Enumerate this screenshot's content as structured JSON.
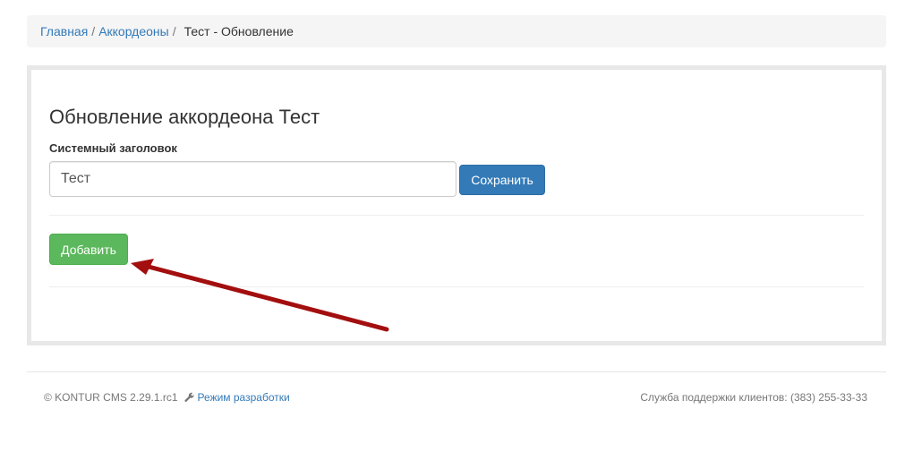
{
  "breadcrumb": {
    "home": "Главная",
    "separator": "/",
    "section": "Аккордеоны",
    "current": "Тест - Обновление"
  },
  "form": {
    "title": "Обновление аккордеона Тест",
    "field_label": "Системный заголовок",
    "field_value": "Тест",
    "save_label": "Сохранить",
    "add_label": "Добавить"
  },
  "annotation": {
    "arrow_color": "#a30e0e",
    "icon": "arrow-pointer-icon"
  },
  "footer": {
    "copyright": "© KONTUR CMS 2.29.1.rc1",
    "dev_icon": "wrench-icon",
    "dev_mode_link": "Режим разработки",
    "support": "Служба поддержки клиентов: (383) 255-33-33"
  },
  "colors": {
    "primary": "#337ab7",
    "success": "#5cb85c",
    "breadcrumb_bg": "#f5f5f5",
    "panel_border": "#e8e8e8"
  }
}
